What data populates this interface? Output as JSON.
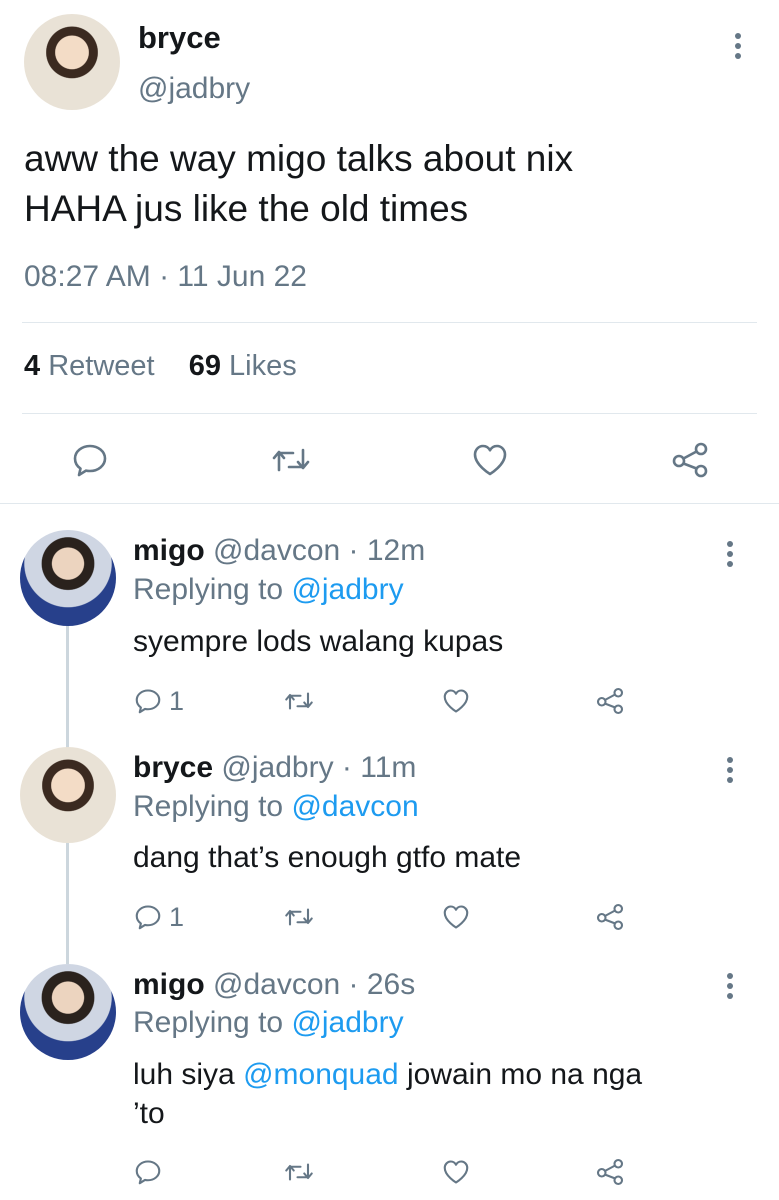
{
  "main_tweet": {
    "author_name": "bryce",
    "author_handle": "@jadbry",
    "text_line1": "aww the way migo talks about nix",
    "text_line2": "HAHA jus like the old times",
    "timestamp": "08:27 AM · 11 Jun 22",
    "retweet_count": "4",
    "retweet_label": "Retweet",
    "like_count": "69",
    "like_label": "Likes"
  },
  "replies": [
    {
      "name": "migo",
      "meta": "@davcon · 12m",
      "replying_prefix": "Replying to",
      "replying_to": "@jadbry",
      "text": "syempre lods walang kupas",
      "reply_count": "1"
    },
    {
      "name": "bryce",
      "meta": "@jadbry · 11m",
      "replying_prefix": "Replying to",
      "replying_to": "@davcon",
      "text": "dang that’s enough gtfo mate",
      "reply_count": "1"
    },
    {
      "name": "migo",
      "meta": "@davcon · 26s",
      "replying_prefix": "Replying to",
      "replying_to": "@jadbry",
      "text_before": "luh siya",
      "mention": "@monquad",
      "text_after": "jowain mo na nga",
      "text_line2": "’to"
    }
  ],
  "icons": {
    "more": "more-vertical-icon",
    "reply": "reply-icon",
    "retweet": "retweet-icon",
    "like": "heart-icon",
    "share": "share-icon"
  },
  "colors": {
    "link": "#1d9bf0",
    "muted": "#657786",
    "divider": "#e1e8ed"
  }
}
